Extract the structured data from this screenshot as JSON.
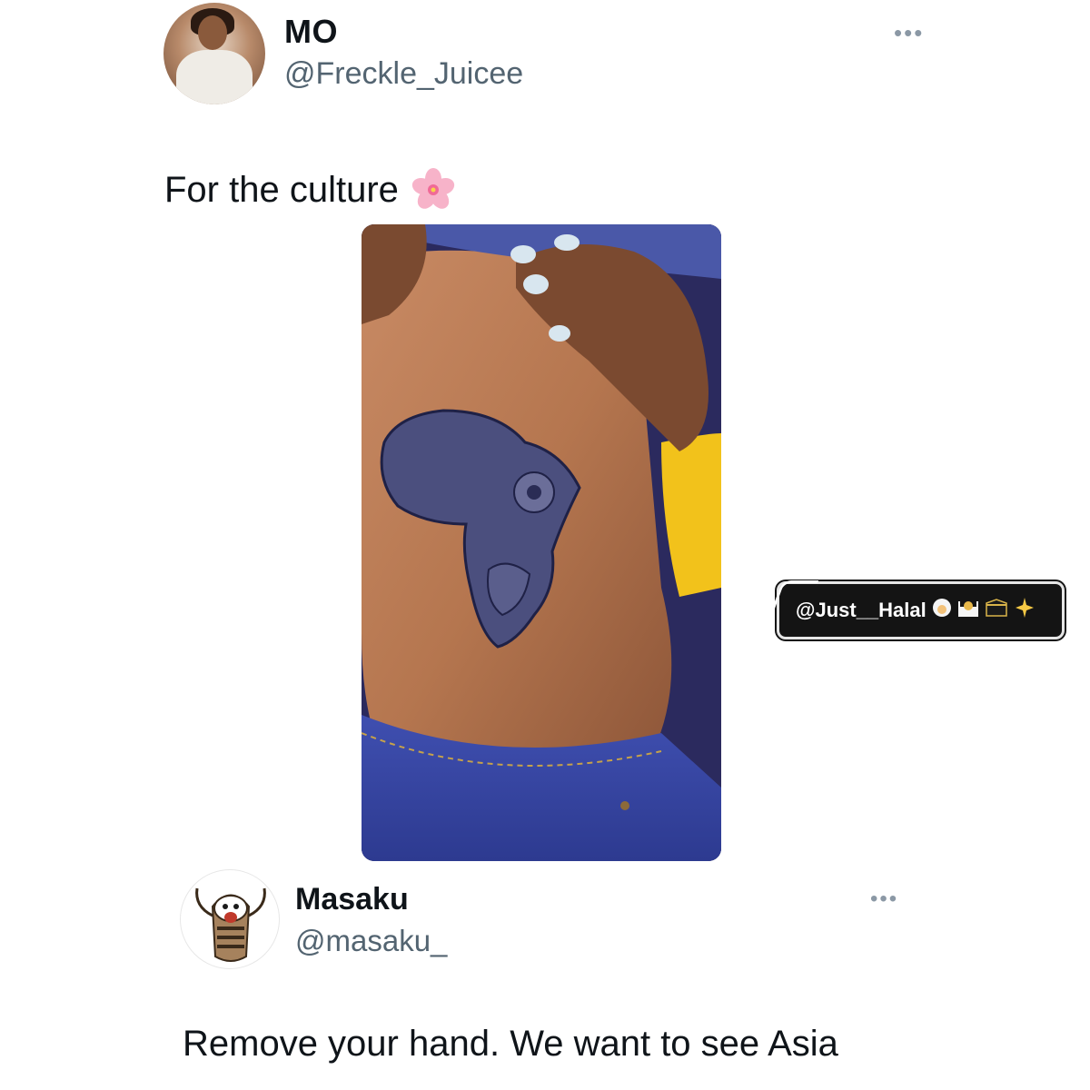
{
  "tweet": {
    "author_name": "MO",
    "author_handle": "@Freckle_Juicee",
    "text": "For the culture",
    "more_label": "•••",
    "emoji_icon": "cherry-blossom-icon"
  },
  "watermark": {
    "text": "@Just__Halal",
    "icons": [
      "woman-with-headscarf-icon",
      "mosque-icon",
      "kaaba-icon",
      "sparkle-icon"
    ]
  },
  "reply": {
    "author_name": "Masaku",
    "author_handle": "@masaku_",
    "text": "Remove your hand. We want to see Asia",
    "more_label": "•••"
  },
  "colors": {
    "text_primary": "#0f1419",
    "text_secondary": "#536471",
    "watermark_bg": "#141414"
  }
}
